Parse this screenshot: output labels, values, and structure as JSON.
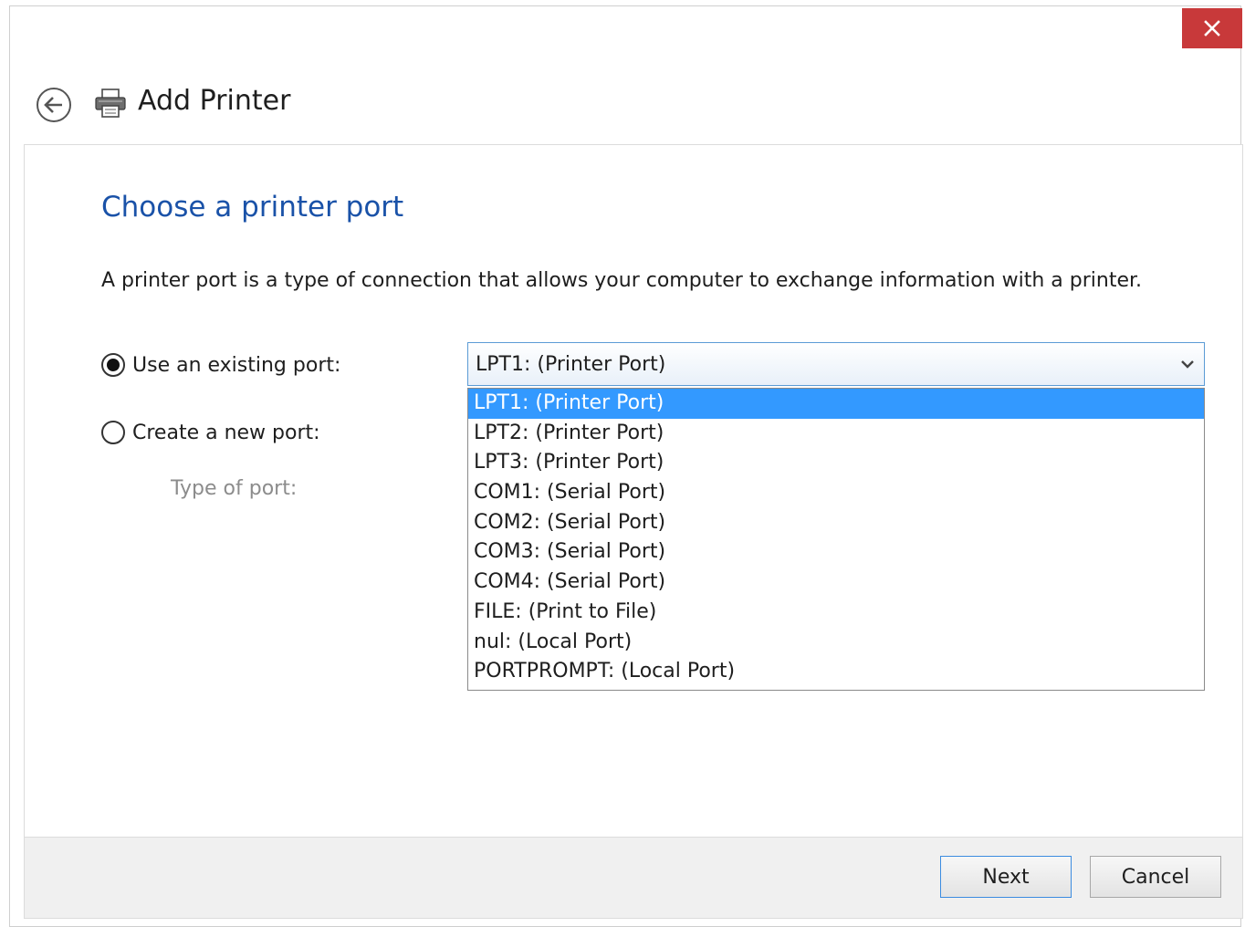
{
  "window": {
    "title": "Add Printer"
  },
  "page": {
    "heading": "Choose a printer port",
    "description": "A printer port is a type of connection that allows your computer to exchange information with a printer."
  },
  "options": {
    "use_existing_label": "Use an existing port:",
    "use_existing_checked": true,
    "create_new_label": "Create a new port:",
    "create_new_checked": false,
    "type_of_port_label": "Type of port:"
  },
  "port_select": {
    "value": "LPT1: (Printer Port)",
    "items": [
      "LPT1: (Printer Port)",
      "LPT2: (Printer Port)",
      "LPT3: (Printer Port)",
      "COM1: (Serial Port)",
      "COM2: (Serial Port)",
      "COM3: (Serial Port)",
      "COM4: (Serial Port)",
      "FILE: (Print to File)",
      "nul: (Local Port)",
      "PORTPROMPT: (Local Port)"
    ],
    "highlighted_index": 0
  },
  "footer": {
    "next_label": "Next",
    "cancel_label": "Cancel"
  },
  "icons": {
    "close": "close-icon",
    "back": "back-arrow-icon",
    "printer": "printer-icon",
    "dropdown": "chevron-down-icon"
  },
  "colors": {
    "close_button": "#c8393a",
    "heading": "#1a52a8",
    "selection": "#3399ff",
    "focus_border": "#3c8ce0"
  }
}
